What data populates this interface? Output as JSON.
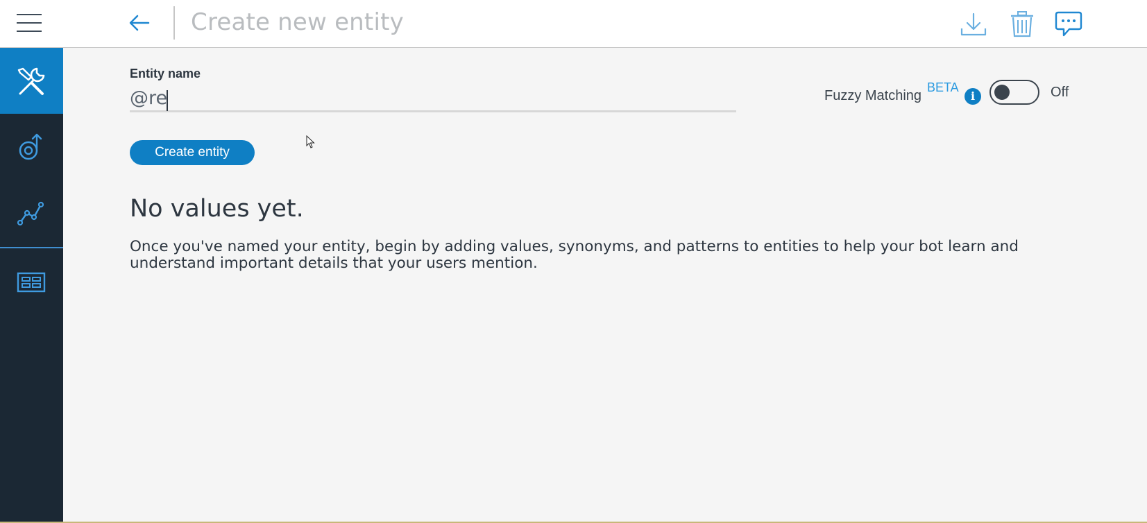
{
  "header": {
    "title": "Create new entity",
    "menu_icon": "hamburger-menu-icon",
    "back_icon": "back-arrow-icon",
    "actions": [
      {
        "name": "download",
        "icon": "download-icon"
      },
      {
        "name": "delete",
        "icon": "trash-icon"
      },
      {
        "name": "try-it",
        "icon": "chat-bubble-icon"
      }
    ]
  },
  "sidebar": {
    "items": [
      {
        "id": "build",
        "icon": "tools-icon",
        "active": true
      },
      {
        "id": "improve",
        "icon": "improve-icon",
        "active": false
      },
      {
        "id": "analytics",
        "icon": "analytics-icon",
        "active": false
      },
      {
        "id": "content-catalog",
        "icon": "catalog-icon",
        "active": false
      }
    ]
  },
  "form": {
    "entity_name_label": "Entity name",
    "entity_name_value": "@re",
    "create_button_label": "Create entity"
  },
  "fuzzy": {
    "label": "Fuzzy Matching",
    "badge": "BETA",
    "info_glyph": "i",
    "state_label": "Off",
    "enabled": false
  },
  "empty_state": {
    "title": "No values yet.",
    "description": "Once you've named your entity, begin by adding values, synonyms, and patterns to entities to help your bot learn and understand important details that your users mention."
  },
  "colors": {
    "accent": "#0f7fc4",
    "sidebar_bg": "#1b2834",
    "beta": "#2b9ae0"
  }
}
